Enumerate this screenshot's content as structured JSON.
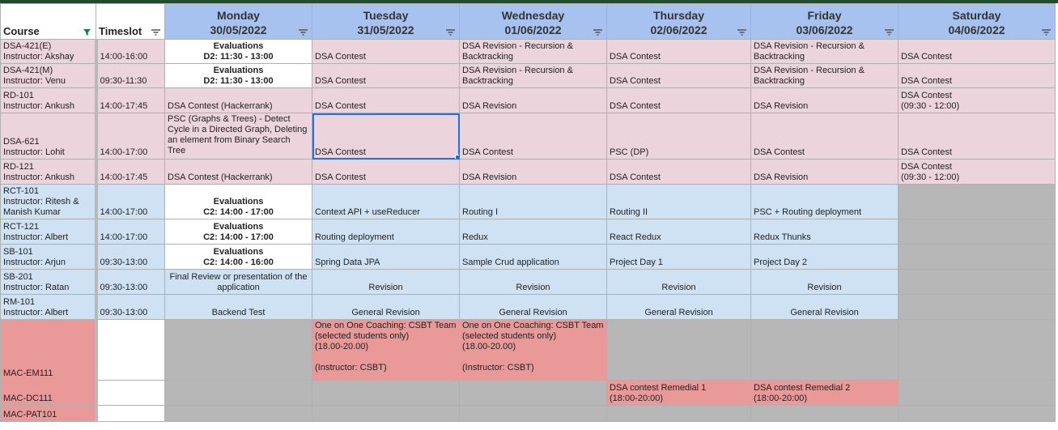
{
  "headers": {
    "course": "Course",
    "timeslot": "Timeslot",
    "days": [
      {
        "name": "Monday",
        "date": "30/05/2022"
      },
      {
        "name": "Tuesday",
        "date": "31/05/2022"
      },
      {
        "name": "Wednesday",
        "date": "01/06/2022"
      },
      {
        "name": "Thursday",
        "date": "02/06/2022"
      },
      {
        "name": "Friday",
        "date": "03/06/2022"
      },
      {
        "name": "Saturday",
        "date": "04/06/2022"
      }
    ]
  },
  "colors": {
    "header_blue": "#a7c2ef",
    "dsa_pink": "#ecd4dc",
    "web_blue": "#cfe2f3",
    "mac_red": "#ea9999",
    "empty_grey": "#b7b7b7",
    "filter_active": "#0b8043",
    "selection": "#1a73e8"
  },
  "rows": [
    {
      "course": "DSA-421(E)\nInstructor: Akshay",
      "timeslot": "14:00-16:00",
      "cells": [
        "Evaluations\nD2: 11:30 - 13:00",
        "DSA Contest",
        "DSA Revision - Recursion & Backtracking",
        "DSA Contest",
        "DSA Revision - Recursion & Backtracking",
        "DSA Contest"
      ]
    },
    {
      "course": "DSA-421(M)\nInstructor: Venu",
      "timeslot": "09:30-11:30",
      "cells": [
        "Evaluations\nD2: 11:30 - 13:00",
        "DSA Contest",
        "DSA Revision - Recursion & Backtracking",
        "DSA Contest",
        "DSA Revision - Recursion & Backtracking",
        "DSA Contest"
      ]
    },
    {
      "course": "RD-101\nInstructor: Ankush",
      "timeslot": "14:00-17:45",
      "cells": [
        "DSA Contest (Hackerrank)",
        "DSA Contest",
        "DSA Revision",
        "DSA Contest",
        "DSA Revision",
        "DSA Contest\n(09:30 - 12:00)"
      ]
    },
    {
      "course": "DSA-621\nInstructor: Lohit",
      "timeslot": "14:00-17:00",
      "cells": [
        "PSC (Graphs & Trees) - Detect Cycle in a Directed Graph, Deleting an element from Binary Search Tree",
        "DSA Contest",
        "DSA Contest",
        "PSC (DP)",
        "DSA Contest",
        "DSA Contest"
      ]
    },
    {
      "course": "RD-121\nInstructor: Ankush",
      "timeslot": "14:00-17:45",
      "cells": [
        "DSA Contest (Hackerrank)",
        "DSA Contest",
        "DSA Revision",
        "DSA Contest",
        "DSA Revision",
        "DSA Contest\n(09:30 - 12:00)"
      ]
    },
    {
      "course": "RCT-101\nInstructor: Ritesh &\nManish Kumar",
      "timeslot": "14:00-17:00",
      "cells": [
        "Evaluations\nC2: 14:00 - 17:00",
        "Context API + useReducer",
        "Routing I",
        "Routing II",
        "PSC + Routing deployment",
        ""
      ]
    },
    {
      "course": "RCT-121\nInstructor: Albert",
      "timeslot": "14:00-17:00",
      "cells": [
        "Evaluations\nC2: 14:00 - 17:00",
        "Routing deployment",
        "Redux",
        "React Redux",
        "Redux Thunks",
        ""
      ]
    },
    {
      "course": "SB-101\nInstructor: Arjun",
      "timeslot": "09:30-13:00",
      "cells": [
        "Evaluations\nC2: 14:00 - 16:00",
        "Spring Data JPA",
        "Sample Crud application",
        "Project Day 1",
        "Project Day 2",
        ""
      ]
    },
    {
      "course": "SB-201\nInstructor: Ratan",
      "timeslot": "09:30-13:00",
      "cells": [
        "Final Review or presentation of the application",
        "Revision",
        "Revision",
        "Revision",
        "Revision",
        ""
      ]
    },
    {
      "course": "RM-101\nInstructor: Albert",
      "timeslot": "09:30-13:00",
      "cells": [
        "Backend Test",
        "General Revision",
        "General Revision",
        "General Revision",
        "General Revision",
        ""
      ]
    },
    {
      "course": "MAC-EM111",
      "timeslot": "",
      "cells": [
        "",
        "One on One Coaching: CSBT Team (selected students only)\n(18.00-20.00)\n\n(Instructor: CSBT)",
        "One on One Coaching: CSBT Team (selected students only)\n(18.00-20.00)\n\n(Instructor: CSBT)",
        "",
        "",
        ""
      ]
    },
    {
      "course": "MAC-DC111",
      "timeslot": "",
      "cells": [
        "",
        "",
        "",
        "DSA contest Remedial 1\n(18:00-20:00)",
        "DSA contest Remedial 2\n(18:00-20:00)",
        ""
      ]
    },
    {
      "course": "MAC-PAT101",
      "timeslot": "",
      "cells": [
        "",
        "",
        "",
        "",
        "",
        ""
      ]
    }
  ]
}
